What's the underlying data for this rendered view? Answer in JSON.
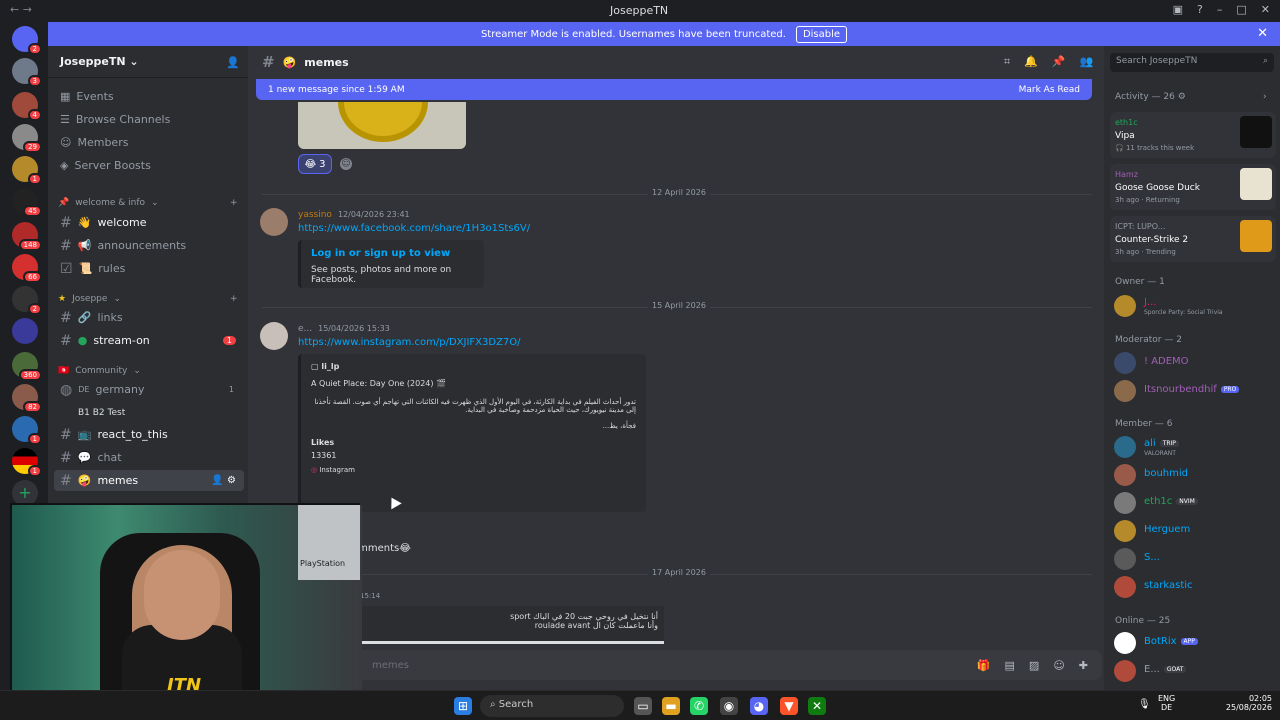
{
  "window": {
    "title": "JoseppeTN",
    "nav_arrows": "← →"
  },
  "banner": {
    "text": "Streamer Mode is enabled. Usernames have been truncated.",
    "button": "Disable"
  },
  "server": {
    "name": "JoseppeTN ⌄"
  },
  "nav": [
    "Events",
    "Browse Channels",
    "Members",
    "Server Boosts"
  ],
  "categories": {
    "welcome": "welcome & info",
    "joseppe": "Joseppe",
    "community": "Community"
  },
  "channels": {
    "welcome": "welcome",
    "announcements": "announcements",
    "rules": "rules",
    "links": "links",
    "stream_on": "stream-on",
    "stream_on_badge": "1",
    "germany": "germany",
    "germany_prefix": "DE",
    "germany_count": "1",
    "b1b2": "B1 B2 Test",
    "react": "react_to_this",
    "chat": "chat",
    "memes": "memes"
  },
  "guild_badges": [
    "2",
    "3",
    "4",
    "29",
    "1",
    "45",
    "148",
    "66",
    "2",
    "360",
    "82",
    "1",
    "1"
  ],
  "header": {
    "channel": "memes",
    "search": "Search JoseppeTN"
  },
  "newbar": {
    "text": "1 new message since 1:59 AM",
    "action": "Mark As Read"
  },
  "reaction": {
    "emoji": "😂",
    "count": "3"
  },
  "dates": [
    "12 April 2026",
    "15 April 2026",
    "17 April 2026"
  ],
  "msg1": {
    "author": "yassino",
    "time": "12/04/2026 23:41",
    "link": "https://www.facebook.com/share/1H3o1Sts6V/",
    "embed_title": "Log in or sign up to view",
    "embed_desc": "See posts, photos and more on Facebook."
  },
  "msg2": {
    "author": "e...",
    "time": "15/04/2026 15:33",
    "link": "https://www.instagram.com/p/DXJIFX3DZ7O/",
    "ig_user": "li_lp",
    "ig_title": "A Quiet Place: Day One (2024) 🎬",
    "ig_text": "تدور أحداث الفيلم في بداية الكارثة، في اليوم الأول الذي ظهرت فيه الكائنات التي تهاجم أي صوت. القصة تأخذنا إلى مدينة نيويورك، حيث الحياة مزدحمة وصاخبة في البداية.",
    "ig_more": "فجأة، يظ...",
    "likes_label": "Likes",
    "likes": "13361",
    "source": "Instagram",
    "after": "omments😂"
  },
  "msg3": {
    "time": "15:14",
    "ar1": "أنا نتخيل في روحي جبت 20 في الباك sport",
    "ar2": "وأنا ماعملت كان ال roulade avant"
  },
  "composer": {
    "placeholder": "memes"
  },
  "activity": {
    "label": "Activity — 26",
    "items": [
      {
        "name": "eth1c",
        "title": "Vipa",
        "sub": "11 tracks this week"
      },
      {
        "name": "Hamz",
        "title": "Goose Goose Duck",
        "sub": "3h ago · Returning"
      },
      {
        "name": "ICPT: LUPO...",
        "title": "Counter-Strike 2",
        "sub": "3h ago · Trending"
      }
    ]
  },
  "groups": {
    "owner": "Owner — 1",
    "moderator": "Moderator — 2",
    "member": "Member — 6",
    "online": "Online — 25"
  },
  "owner": {
    "name": "J...",
    "sub": "Sporcle Party: Social Trivia"
  },
  "mods": [
    {
      "name": "! ADEMO"
    },
    {
      "name": "Itsnourbendhif",
      "tag": "PRO"
    }
  ],
  "member_list": [
    {
      "name": "ali",
      "tag": "TRIP",
      "sub": "VALORANT"
    },
    {
      "name": "bouhmid"
    },
    {
      "name": "eth1c",
      "tag": "NVIM"
    },
    {
      "name": "Herguem"
    },
    {
      "name": "S..."
    },
    {
      "name": "starkastic"
    }
  ],
  "online_list": [
    {
      "name": "BotRix",
      "tag": "APP"
    },
    {
      "name": "E...",
      "tag": "GOAT"
    }
  ],
  "webcam": {
    "ps": "PlayStation",
    "logo": "JTN"
  },
  "taskbar": {
    "search": "Search",
    "lang": "ENG",
    "kb": "DE",
    "time": "02:05",
    "date": "25/08/2026"
  }
}
